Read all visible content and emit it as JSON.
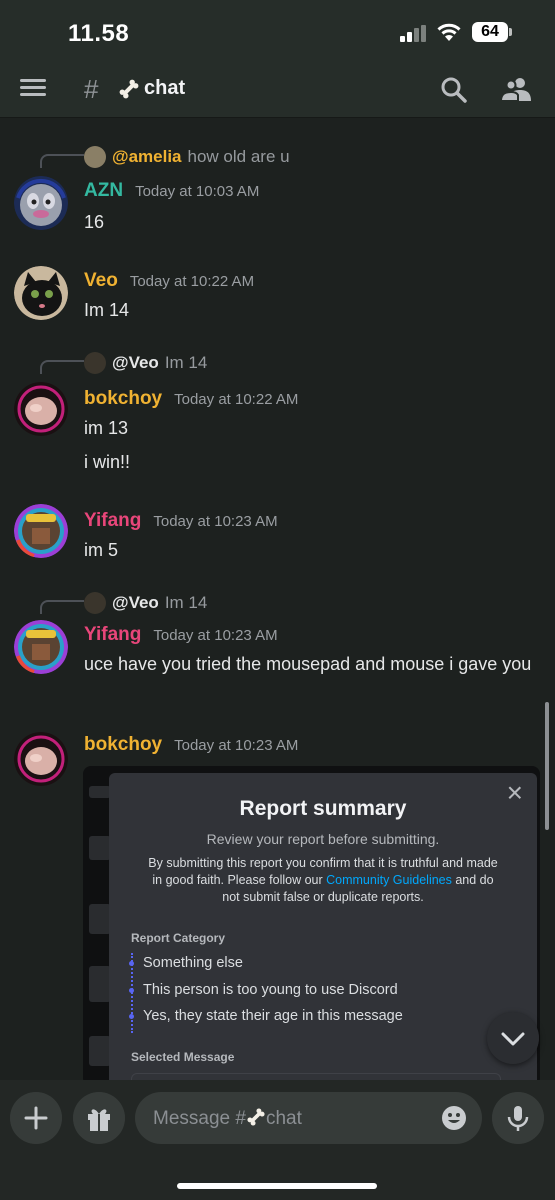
{
  "status_bar": {
    "time": "11.58",
    "battery": "64"
  },
  "header": {
    "hash": "#",
    "channel": "chat",
    "channel_icon": "bone-icon"
  },
  "messages": [
    {
      "reply_to": {
        "mention": "@amelia",
        "preview": "how old are u",
        "mention_color": "#f0b232"
      },
      "author": "AZN",
      "author_color": "#34b9a1",
      "time": "Today at 10:03 AM",
      "lines": [
        "16"
      ]
    },
    {
      "author": "Veo",
      "author_color": "#f0b232",
      "time": "Today at 10:22 AM",
      "lines": [
        "Im 14"
      ]
    },
    {
      "reply_to": {
        "mention": "@Veo",
        "preview": "Im 14",
        "mention_color": "#e6e7e8"
      },
      "author": "bokchoy",
      "author_color": "#f0b232",
      "time": "Today at 10:22 AM",
      "lines": [
        "im 13",
        "i win!!"
      ]
    },
    {
      "author": "Yifang",
      "author_color": "#e8467a",
      "time": "Today at 10:23 AM",
      "lines": [
        "im 5"
      ]
    },
    {
      "reply_to": {
        "mention": "@Veo",
        "preview": "Im 14",
        "mention_color": "#e6e7e8"
      },
      "author": "Yifang",
      "author_color": "#e8467a",
      "time": "Today at 10:23 AM",
      "lines": [
        "uce have you tried the mousepad and mouse i gave you"
      ]
    },
    {
      "author": "bokchoy",
      "author_color": "#f0b232",
      "time": "Today at 10:23 AM",
      "lines": []
    }
  ],
  "report": {
    "close": "×",
    "title": "Report summary",
    "subtitle": "Review your report before submitting.",
    "desc_before": "By submitting this report you confirm that it is truthful and made in good faith. Please follow our ",
    "desc_link": "Community Guidelines",
    "desc_after": " and do not submit false or duplicate reports.",
    "category_label": "Report Category",
    "categories": [
      "Something else",
      "This person is too young to use Discord",
      "Yes, they state their age in this message"
    ],
    "selected_label": "Selected Message"
  },
  "composer": {
    "placeholder_prefix": "Message #",
    "placeholder_channel": "chat"
  },
  "colors": {
    "accent": "#5865f2",
    "link": "#00a8fc",
    "background": "#1d211f"
  }
}
